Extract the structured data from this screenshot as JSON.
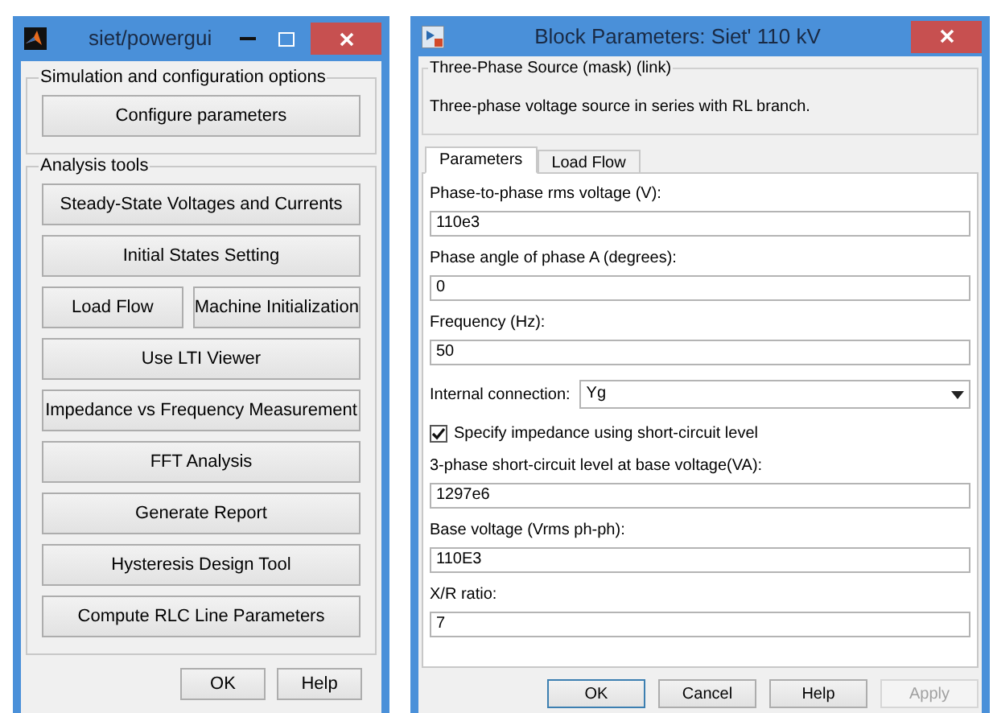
{
  "powergui": {
    "title": "siet/powergui",
    "groups": [
      {
        "title": "Simulation and configuration options",
        "rows": [
          [
            "Configure parameters"
          ]
        ]
      },
      {
        "title": "Analysis tools",
        "rows": [
          [
            "Steady-State Voltages and Currents"
          ],
          [
            "Initial States Setting"
          ],
          [
            "Load Flow",
            "Machine Initialization"
          ],
          [
            "Use LTI Viewer"
          ],
          [
            "Impedance vs Frequency Measurement"
          ],
          [
            "FFT Analysis"
          ],
          [
            "Generate Report"
          ],
          [
            "Hysteresis Design Tool"
          ],
          [
            "Compute RLC  Line Parameters"
          ]
        ]
      }
    ],
    "buttons": [
      "OK",
      "Help"
    ]
  },
  "block_parameters": {
    "title": "Block Parameters: Siet' 110 kV",
    "mask_title": "Three-Phase Source (mask) (link)",
    "description": "Three-phase voltage source in series with RL branch.",
    "tabs": [
      {
        "label": "Parameters",
        "selected": true
      },
      {
        "label": "Load Flow",
        "selected": false
      }
    ],
    "params": [
      {
        "kind": "text",
        "label": "Phase-to-phase rms voltage (V):",
        "value": "110e3"
      },
      {
        "kind": "text",
        "label": "Phase angle of phase A (degrees):",
        "value": "0"
      },
      {
        "kind": "text",
        "label": "Frequency (Hz):",
        "value": "50"
      },
      {
        "kind": "select",
        "label": "Internal connection:",
        "value": "Yg"
      },
      {
        "kind": "checkbox",
        "label": "Specify impedance using short-circuit level",
        "checked": true
      },
      {
        "kind": "text",
        "label": "3-phase short-circuit level at base voltage(VA):",
        "value": "1297e6"
      },
      {
        "kind": "text",
        "label": "Base voltage (Vrms ph-ph):",
        "value": "110E3"
      },
      {
        "kind": "text",
        "label": "X/R ratio:",
        "value": "7"
      }
    ],
    "buttons": [
      {
        "label": "OK",
        "focused": true,
        "disabled": false
      },
      {
        "label": "Cancel",
        "focused": false,
        "disabled": false
      },
      {
        "label": "Help",
        "focused": false,
        "disabled": false
      },
      {
        "label": "Apply",
        "focused": false,
        "disabled": true
      }
    ]
  }
}
